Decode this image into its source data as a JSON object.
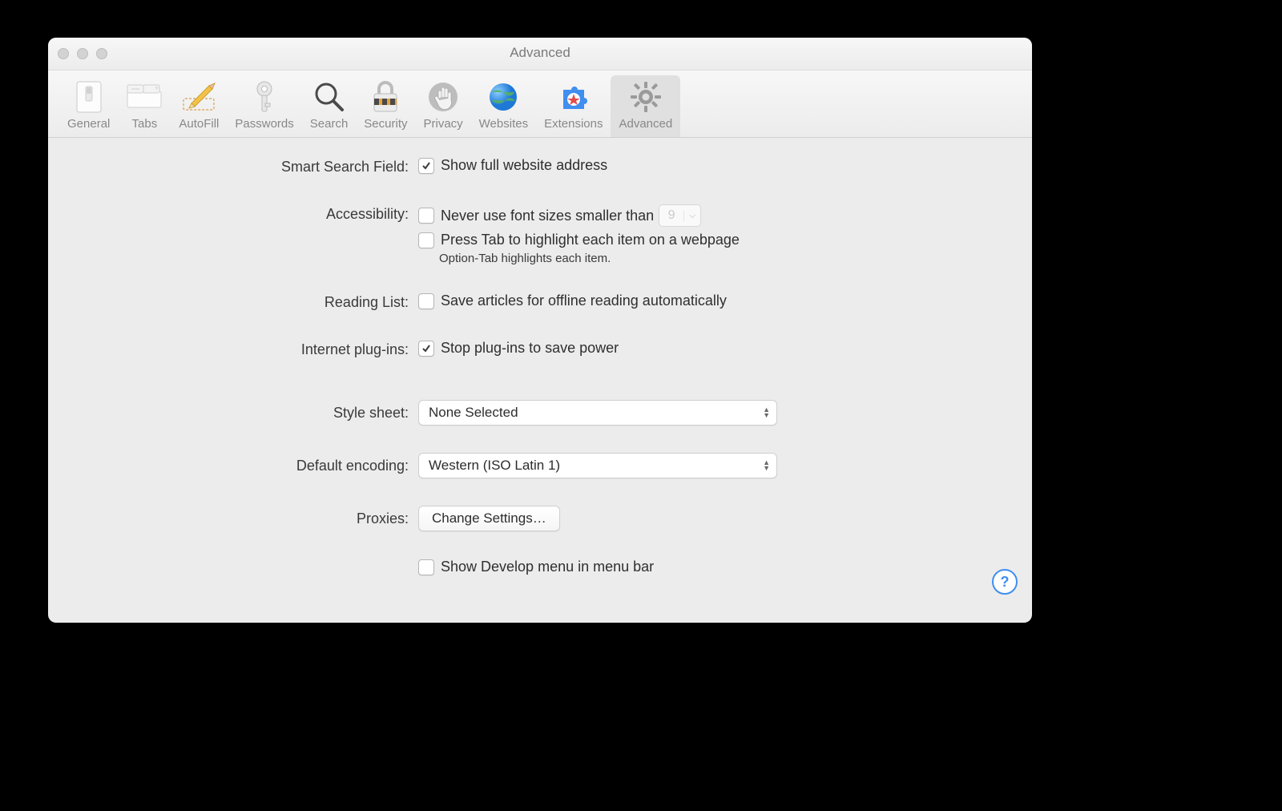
{
  "window": {
    "title": "Advanced"
  },
  "toolbar": {
    "items": [
      {
        "id": "general",
        "label": "General"
      },
      {
        "id": "tabs",
        "label": "Tabs"
      },
      {
        "id": "autofill",
        "label": "AutoFill"
      },
      {
        "id": "passwords",
        "label": "Passwords"
      },
      {
        "id": "search",
        "label": "Search"
      },
      {
        "id": "security",
        "label": "Security"
      },
      {
        "id": "privacy",
        "label": "Privacy"
      },
      {
        "id": "websites",
        "label": "Websites"
      },
      {
        "id": "extensions",
        "label": "Extensions"
      },
      {
        "id": "advanced",
        "label": "Advanced"
      }
    ],
    "selected": "advanced"
  },
  "sections": {
    "smart_search": {
      "label": "Smart Search Field:",
      "show_full_address": {
        "label": "Show full website address",
        "checked": true
      }
    },
    "accessibility": {
      "label": "Accessibility:",
      "min_font": {
        "label": "Never use font sizes smaller than",
        "checked": false,
        "value": "9"
      },
      "tab_focus": {
        "label": "Press Tab to highlight each item on a webpage",
        "checked": false
      },
      "hint": "Option-Tab highlights each item."
    },
    "reading_list": {
      "label": "Reading List:",
      "offline": {
        "label": "Save articles for offline reading automatically",
        "checked": false
      }
    },
    "plugins": {
      "label": "Internet plug-ins:",
      "stop_power": {
        "label": "Stop plug-ins to save power",
        "checked": true
      }
    },
    "stylesheet": {
      "label": "Style sheet:",
      "value": "None Selected"
    },
    "encoding": {
      "label": "Default encoding:",
      "value": "Western (ISO Latin 1)"
    },
    "proxies": {
      "label": "Proxies:",
      "button": "Change Settings…"
    },
    "develop": {
      "label": "Show Develop menu in menu bar",
      "checked": false
    }
  },
  "help_tooltip": "?"
}
